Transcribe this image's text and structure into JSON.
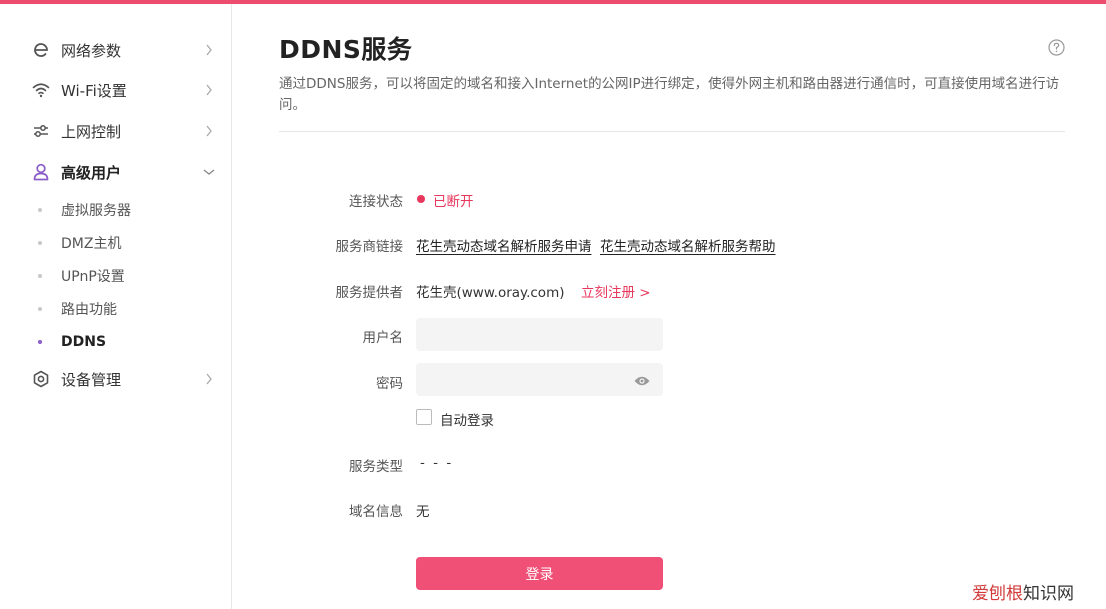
{
  "sidebar": {
    "items": [
      {
        "label": "网络参数",
        "icon": "network-e-icon",
        "chevron": "right"
      },
      {
        "label": "Wi-Fi设置",
        "icon": "wifi-icon",
        "chevron": "right"
      },
      {
        "label": "上网控制",
        "icon": "sliders-icon",
        "chevron": "right"
      },
      {
        "label": "高级用户",
        "icon": "user-icon",
        "chevron": "down"
      },
      {
        "label": "设备管理",
        "icon": "gear-icon",
        "chevron": "right"
      }
    ],
    "subitems": [
      {
        "label": "虚拟服务器"
      },
      {
        "label": "DMZ主机"
      },
      {
        "label": "UPnP设置"
      },
      {
        "label": "路由功能"
      },
      {
        "label": "DDNS",
        "active": true
      }
    ]
  },
  "main": {
    "title": "DDNS服务",
    "description": "通过DDNS服务，可以将固定的域名和接入Internet的公网IP进行绑定，使得外网主机和路由器进行通信时，可直接使用域名进行访问。",
    "form": {
      "status_label": "连接状态",
      "status_value": "已断开",
      "provider_link_label": "服务商链接",
      "link_apply": "花生壳动态域名解析服务申请",
      "link_help": "花生壳动态域名解析服务帮助",
      "provider_label": "服务提供者",
      "provider_value": "花生壳(www.oray.com)",
      "register_link": "立刻注册 >",
      "username_label": "用户名",
      "username_value": "",
      "password_label": "密码",
      "password_value": "",
      "auto_login_label": "自动登录",
      "auto_login_checked": false,
      "service_type_label": "服务类型",
      "service_type_value": "- - -",
      "domain_info_label": "域名信息",
      "domain_info_value": "无",
      "login_button": "登录"
    }
  },
  "watermark": {
    "part1": "爱刨根",
    "part2": "知识网"
  },
  "colors": {
    "accent": "#ec4d6e",
    "status_red": "#e8375d",
    "button": "#f04f76",
    "active_purple": "#8a5cc9"
  }
}
